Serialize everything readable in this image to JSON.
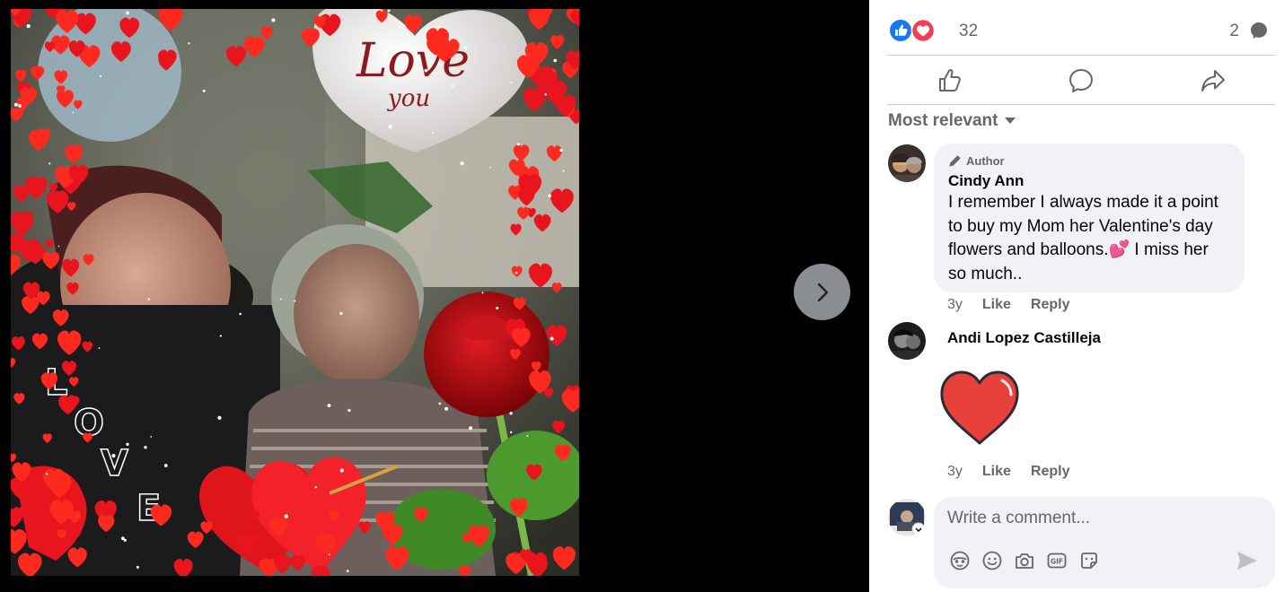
{
  "viewer": {
    "photo_alt": "",
    "next_icon": "chevron-right-icon"
  },
  "reactions": {
    "icons": [
      "like-icon",
      "love-icon"
    ],
    "count": "32",
    "comment_count": "2",
    "comment_count_icon": "comment-icon"
  },
  "actions": [
    {
      "name": "like-action",
      "icon": "thumbs-up-icon"
    },
    {
      "name": "comment-action",
      "icon": "comment-bubble-icon"
    },
    {
      "name": "share-action",
      "icon": "share-arrow-icon"
    }
  ],
  "sort": {
    "label": "Most relevant"
  },
  "comments": [
    {
      "badge": "Author",
      "badge_icon": "pencil-icon",
      "name": "Cindy Ann",
      "text": "I remember I always made it a point to buy my Mom her Valentine's day flowers and balloons.💕 I miss her so much..",
      "time": "3y",
      "like_label": "Like",
      "reply_label": "Reply"
    },
    {
      "name": "Andi Lopez Castilleja",
      "sticker": "heart-sticker-icon",
      "time": "3y",
      "like_label": "Like",
      "reply_label": "Reply"
    }
  ],
  "composer": {
    "placeholder": "Write a comment...",
    "tools": [
      "avatar-sticker-icon",
      "emoji-icon",
      "camera-icon",
      "gif-icon",
      "sticker-icon"
    ],
    "send_icon": "send-icon"
  },
  "colors": {
    "like_blue": "#1877f2",
    "love_red": "#f33e58",
    "secondary_text": "#65676b",
    "bubble_bg": "#f0f2f5",
    "heart_red": "#e8403a"
  }
}
